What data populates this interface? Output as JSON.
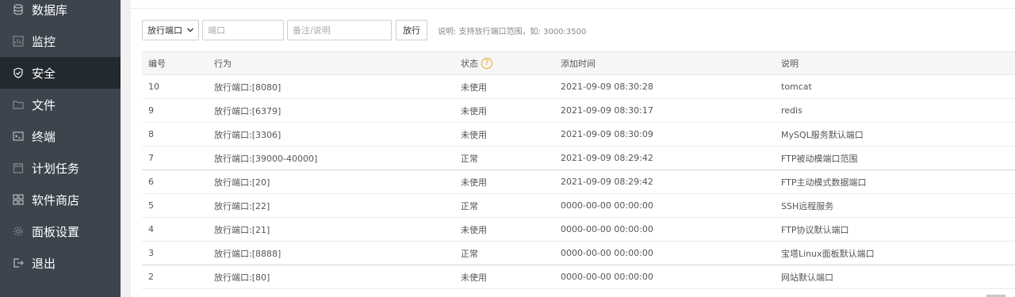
{
  "sidebar": {
    "items": [
      {
        "label": "数据库",
        "icon": "database-icon",
        "active": false
      },
      {
        "label": "监控",
        "icon": "monitor-icon",
        "active": false
      },
      {
        "label": "安全",
        "icon": "shield-icon",
        "active": true
      },
      {
        "label": "文件",
        "icon": "folder-icon",
        "active": false
      },
      {
        "label": "终端",
        "icon": "terminal-icon",
        "active": false
      },
      {
        "label": "计划任务",
        "icon": "calendar-icon",
        "active": false
      },
      {
        "label": "软件商店",
        "icon": "grid-icon",
        "active": false
      },
      {
        "label": "面板设置",
        "icon": "gear-icon",
        "active": false
      },
      {
        "label": "退出",
        "icon": "logout-icon",
        "active": false
      }
    ]
  },
  "toolbar": {
    "select_value": "放行端口",
    "port_placeholder": "端口",
    "note_placeholder": "备注/说明",
    "submit_label": "放行",
    "hint": "说明: 支持放行端口范围，如: 3000:3500"
  },
  "table": {
    "headers": {
      "id": "编号",
      "action": "行为",
      "status": "状态",
      "status_help": "?",
      "time": "添加时间",
      "desc": "说明"
    },
    "rows": [
      {
        "id": "10",
        "action": "放行端口:[8080]",
        "status": "未使用",
        "time": "2021-09-09 08:30:28",
        "desc": "tomcat"
      },
      {
        "id": "9",
        "action": "放行端口:[6379]",
        "status": "未使用",
        "time": "2021-09-09 08:30:17",
        "desc": "redis"
      },
      {
        "id": "8",
        "action": "放行端口:[3306]",
        "status": "未使用",
        "time": "2021-09-09 08:30:09",
        "desc": "MySQL服务默认端口"
      },
      {
        "id": "7",
        "action": "放行端口:[39000-40000]",
        "status": "正常",
        "time": "2021-09-09 08:29:42",
        "desc": "FTP被动模端口范围"
      },
      {
        "id": "6",
        "action": "放行端口:[20]",
        "status": "未使用",
        "time": "2021-09-09 08:29:42",
        "desc": "FTP主动模式数据端口"
      },
      {
        "id": "5",
        "action": "放行端口:[22]",
        "status": "正常",
        "time": "0000-00-00 00:00:00",
        "desc": "SSH远程服务"
      },
      {
        "id": "4",
        "action": "放行端口:[21]",
        "status": "未使用",
        "time": "0000-00-00 00:00:00",
        "desc": "FTP协议默认端口"
      },
      {
        "id": "3",
        "action": "放行端口:[8888]",
        "status": "正常",
        "time": "0000-00-00 00:00:00",
        "desc": "宝塔Linux面板默认端口"
      },
      {
        "id": "2",
        "action": "放行端口:[80]",
        "status": "未使用",
        "time": "0000-00-00 00:00:00",
        "desc": "网站默认端口"
      }
    ]
  },
  "colors": {
    "sidebar_bg": "#3c444d",
    "sidebar_active_bg": "#22292f",
    "help_accent": "#f5a623"
  }
}
